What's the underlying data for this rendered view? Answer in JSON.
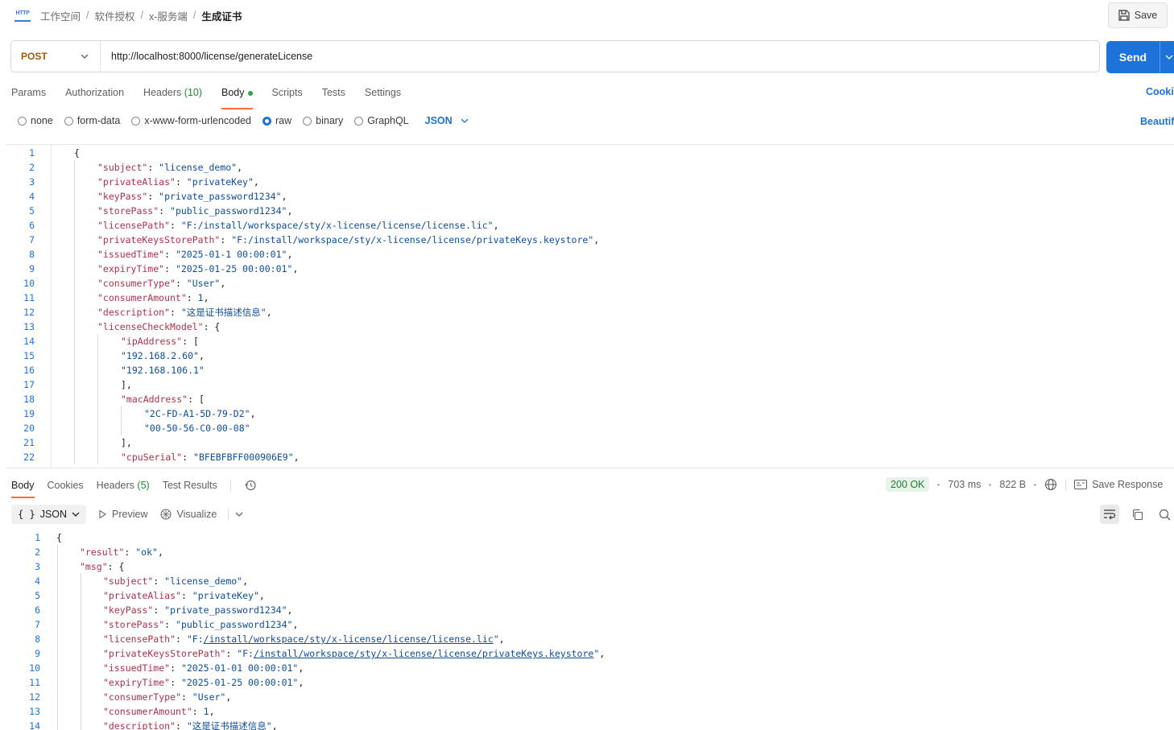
{
  "breadcrumb": {
    "protocol_icon": "HTTP",
    "items": [
      "工作空间",
      "软件授权",
      "x-服务端"
    ],
    "current": "生成证书"
  },
  "toolbar": {
    "save_label": "Save"
  },
  "request": {
    "method": "POST",
    "url": "http://localhost:8000/license/generateLicense",
    "send_label": "Send"
  },
  "request_tabs": [
    {
      "label": "Params"
    },
    {
      "label": "Authorization"
    },
    {
      "label": "Headers",
      "count": "(10)"
    },
    {
      "label": "Body",
      "active": true
    },
    {
      "label": "Scripts"
    },
    {
      "label": "Tests"
    },
    {
      "label": "Settings"
    }
  ],
  "cookies_label": "Cookies",
  "body_types": [
    "none",
    "form-data",
    "x-www-form-urlencoded",
    "raw",
    "binary",
    "GraphQL"
  ],
  "body_type_selected": "raw",
  "body_language": "JSON",
  "beautify_label": "Beautify",
  "request_body": [
    {
      "indent": 0,
      "parts": [
        [
          "p",
          "{"
        ]
      ]
    },
    {
      "indent": 1,
      "parts": [
        [
          "k",
          "\"subject\""
        ],
        [
          "p",
          ": "
        ],
        [
          "s",
          "\"license_demo\""
        ],
        [
          "p",
          ","
        ]
      ]
    },
    {
      "indent": 1,
      "parts": [
        [
          "k",
          "\"privateAlias\""
        ],
        [
          "p",
          ": "
        ],
        [
          "s",
          "\"privateKey\""
        ],
        [
          "p",
          ","
        ]
      ]
    },
    {
      "indent": 1,
      "parts": [
        [
          "k",
          "\"keyPass\""
        ],
        [
          "p",
          ": "
        ],
        [
          "s",
          "\"private_password1234\""
        ],
        [
          "p",
          ","
        ]
      ]
    },
    {
      "indent": 1,
      "parts": [
        [
          "k",
          "\"storePass\""
        ],
        [
          "p",
          ": "
        ],
        [
          "s",
          "\"public_password1234\""
        ],
        [
          "p",
          ","
        ]
      ]
    },
    {
      "indent": 1,
      "parts": [
        [
          "k",
          "\"licensePath\""
        ],
        [
          "p",
          ": "
        ],
        [
          "s",
          "\"F:/install/workspace/sty/x-license/license/license.lic\""
        ],
        [
          "p",
          ","
        ]
      ]
    },
    {
      "indent": 1,
      "parts": [
        [
          "k",
          "\"privateKeysStorePath\""
        ],
        [
          "p",
          ": "
        ],
        [
          "s",
          "\"F:/install/workspace/sty/x-license/license/privateKeys.keystore\""
        ],
        [
          "p",
          ","
        ]
      ]
    },
    {
      "indent": 1,
      "parts": [
        [
          "k",
          "\"issuedTime\""
        ],
        [
          "p",
          ": "
        ],
        [
          "s",
          "\"2025-01-1 00:00:01\""
        ],
        [
          "p",
          ","
        ]
      ]
    },
    {
      "indent": 1,
      "parts": [
        [
          "k",
          "\"expiryTime\""
        ],
        [
          "p",
          ": "
        ],
        [
          "s",
          "\"2025-01-25 00:00:01\""
        ],
        [
          "p",
          ","
        ]
      ]
    },
    {
      "indent": 1,
      "parts": [
        [
          "k",
          "\"consumerType\""
        ],
        [
          "p",
          ": "
        ],
        [
          "s",
          "\"User\""
        ],
        [
          "p",
          ","
        ]
      ]
    },
    {
      "indent": 1,
      "parts": [
        [
          "k",
          "\"consumerAmount\""
        ],
        [
          "p",
          ": "
        ],
        [
          "n",
          "1"
        ],
        [
          "p",
          ","
        ]
      ]
    },
    {
      "indent": 1,
      "parts": [
        [
          "k",
          "\"description\""
        ],
        [
          "p",
          ": "
        ],
        [
          "s",
          "\"这是证书描述信息\""
        ],
        [
          "p",
          ","
        ]
      ]
    },
    {
      "indent": 1,
      "parts": [
        [
          "k",
          "\"licenseCheckModel\""
        ],
        [
          "p",
          ": {"
        ]
      ]
    },
    {
      "indent": 2,
      "parts": [
        [
          "k",
          "\"ipAddress\""
        ],
        [
          "p",
          ": ["
        ]
      ]
    },
    {
      "indent": 2,
      "parts": [
        [
          "s",
          "\"192.168.2.60\""
        ],
        [
          "p",
          ","
        ]
      ]
    },
    {
      "indent": 2,
      "parts": [
        [
          "s",
          "\"192.168.106.1\""
        ]
      ]
    },
    {
      "indent": 2,
      "parts": [
        [
          "p",
          "],"
        ]
      ]
    },
    {
      "indent": 2,
      "parts": [
        [
          "k",
          "\"macAddress\""
        ],
        [
          "p",
          ": ["
        ]
      ]
    },
    {
      "indent": 3,
      "parts": [
        [
          "s",
          "\"2C-FD-A1-5D-79-D2\""
        ],
        [
          "p",
          ","
        ]
      ]
    },
    {
      "indent": 3,
      "parts": [
        [
          "s",
          "\"00-50-56-C0-00-08\""
        ]
      ]
    },
    {
      "indent": 2,
      "parts": [
        [
          "p",
          "],"
        ]
      ]
    },
    {
      "indent": 2,
      "parts": [
        [
          "k",
          "\"cpuSerial\""
        ],
        [
          "p",
          ": "
        ],
        [
          "s",
          "\"BFEBFBFF000906E9\""
        ],
        [
          "p",
          ","
        ]
      ]
    }
  ],
  "response_tabs": [
    {
      "label": "Body",
      "active": true
    },
    {
      "label": "Cookies"
    },
    {
      "label": "Headers",
      "count": "(5)"
    },
    {
      "label": "Test Results"
    }
  ],
  "response_status": {
    "code": "200 OK",
    "time": "703 ms",
    "size": "822 B",
    "save_label": "Save Response"
  },
  "response_format": "JSON",
  "response_preview_label": "Preview",
  "response_visualize_label": "Visualize",
  "response_body": [
    {
      "indent": 0,
      "parts": [
        [
          "p",
          "{"
        ]
      ]
    },
    {
      "indent": 1,
      "parts": [
        [
          "k",
          "\"result\""
        ],
        [
          "p",
          ": "
        ],
        [
          "s",
          "\"ok\""
        ],
        [
          "p",
          ","
        ]
      ]
    },
    {
      "indent": 1,
      "parts": [
        [
          "k",
          "\"msg\""
        ],
        [
          "p",
          ": {"
        ]
      ]
    },
    {
      "indent": 2,
      "parts": [
        [
          "k",
          "\"subject\""
        ],
        [
          "p",
          ": "
        ],
        [
          "s",
          "\"license_demo\""
        ],
        [
          "p",
          ","
        ]
      ]
    },
    {
      "indent": 2,
      "parts": [
        [
          "k",
          "\"privateAlias\""
        ],
        [
          "p",
          ": "
        ],
        [
          "s",
          "\"privateKey\""
        ],
        [
          "p",
          ","
        ]
      ]
    },
    {
      "indent": 2,
      "parts": [
        [
          "k",
          "\"keyPass\""
        ],
        [
          "p",
          ": "
        ],
        [
          "s",
          "\"private_password1234\""
        ],
        [
          "p",
          ","
        ]
      ]
    },
    {
      "indent": 2,
      "parts": [
        [
          "k",
          "\"storePass\""
        ],
        [
          "p",
          ": "
        ],
        [
          "s",
          "\"public_password1234\""
        ],
        [
          "p",
          ","
        ]
      ]
    },
    {
      "indent": 2,
      "parts": [
        [
          "k",
          "\"licensePath\""
        ],
        [
          "p",
          ": "
        ],
        [
          "s",
          "\"F:"
        ],
        [
          "su",
          "/install/workspace/sty/x-license/license/license.lic"
        ],
        [
          "s",
          "\""
        ],
        [
          "p",
          ","
        ]
      ]
    },
    {
      "indent": 2,
      "parts": [
        [
          "k",
          "\"privateKeysStorePath\""
        ],
        [
          "p",
          ": "
        ],
        [
          "s",
          "\"F:"
        ],
        [
          "su",
          "/install/workspace/sty/x-license/license/privateKeys.keystore"
        ],
        [
          "s",
          "\""
        ],
        [
          "p",
          ","
        ]
      ]
    },
    {
      "indent": 2,
      "parts": [
        [
          "k",
          "\"issuedTime\""
        ],
        [
          "p",
          ": "
        ],
        [
          "s",
          "\"2025-01-01 00:00:01\""
        ],
        [
          "p",
          ","
        ]
      ]
    },
    {
      "indent": 2,
      "parts": [
        [
          "k",
          "\"expiryTime\""
        ],
        [
          "p",
          ": "
        ],
        [
          "s",
          "\"2025-01-25 00:00:01\""
        ],
        [
          "p",
          ","
        ]
      ]
    },
    {
      "indent": 2,
      "parts": [
        [
          "k",
          "\"consumerType\""
        ],
        [
          "p",
          ": "
        ],
        [
          "s",
          "\"User\""
        ],
        [
          "p",
          ","
        ]
      ]
    },
    {
      "indent": 2,
      "parts": [
        [
          "k",
          "\"consumerAmount\""
        ],
        [
          "p",
          ": "
        ],
        [
          "n",
          "1"
        ],
        [
          "p",
          ","
        ]
      ]
    },
    {
      "indent": 2,
      "parts": [
        [
          "k",
          "\"description\""
        ],
        [
          "p",
          ": "
        ],
        [
          "s",
          "\"这是证书描述信息\""
        ],
        [
          "p",
          ","
        ]
      ]
    }
  ]
}
